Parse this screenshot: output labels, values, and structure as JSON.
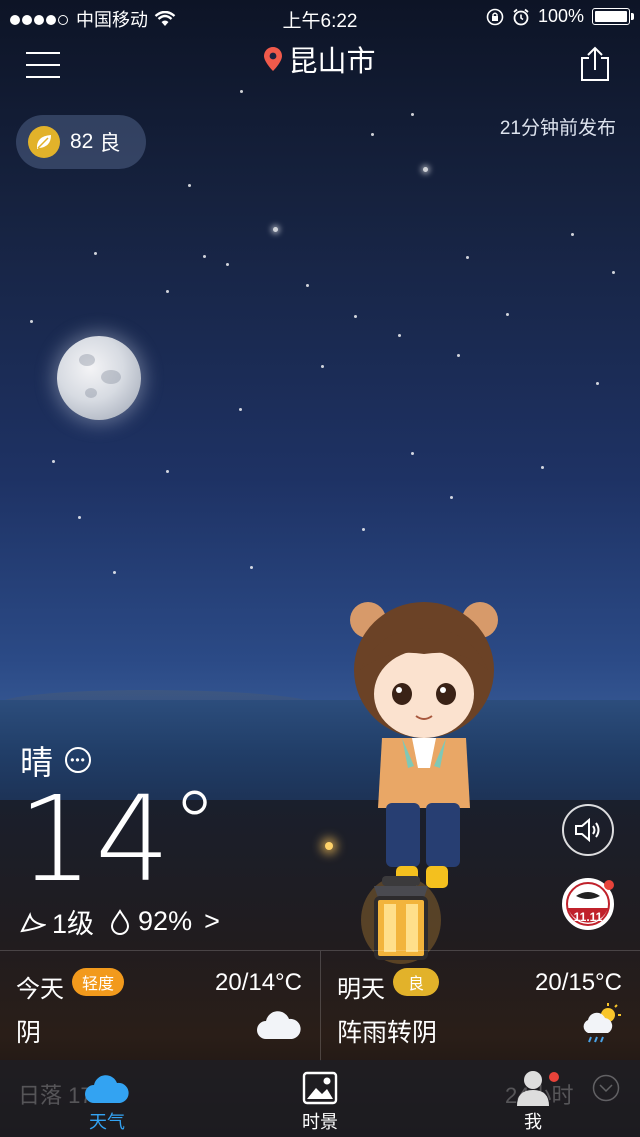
{
  "status_bar": {
    "carrier": "中国移动",
    "time": "上午6:22",
    "battery": "100%"
  },
  "header": {
    "city": "昆山市",
    "published": "21分钟前发布"
  },
  "aqi": {
    "value": "82",
    "level": "良",
    "color": "#e2b22a"
  },
  "current": {
    "condition": "晴",
    "temperature": "14",
    "degree": "°",
    "wind": "1级",
    "humidity": "92%",
    "more": ">"
  },
  "forecast": {
    "today": {
      "label": "今天",
      "badge": "轻度",
      "badge_color": "#f29a1c",
      "range": "20/14°C",
      "desc": "阴",
      "icon": "cloudy-icon"
    },
    "tomorrow": {
      "label": "明天",
      "badge": "良",
      "badge_color": "#e2b22a",
      "range": "20/15°C",
      "desc": "阵雨转阴",
      "icon": "shower-sun-icon"
    }
  },
  "promo": {
    "label": "11.11"
  },
  "tabbar": {
    "ghost_left": "日落 17",
    "ghost_right": "24小时",
    "tabs": [
      {
        "label": "天气",
        "icon": "cloud-icon",
        "active": true
      },
      {
        "label": "时景",
        "icon": "photo-icon",
        "active": false
      },
      {
        "label": "我",
        "icon": "user-icon",
        "active": false
      }
    ],
    "active_color": "#33a3f2"
  }
}
